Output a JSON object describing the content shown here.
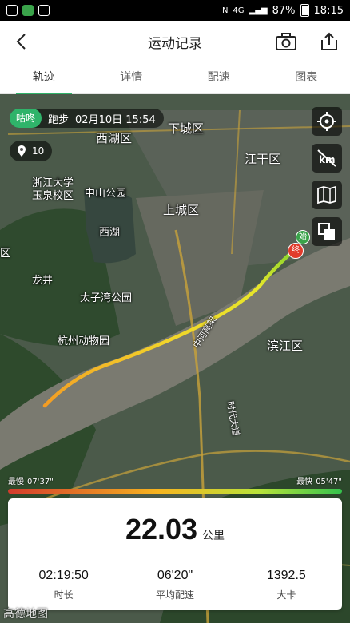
{
  "status_bar": {
    "battery": "87%",
    "time": "18:15",
    "network": "4G"
  },
  "header": {
    "title": "运动记录"
  },
  "tabs": [
    {
      "label": "轨迹",
      "active": true
    },
    {
      "label": "详情",
      "active": false
    },
    {
      "label": "配速",
      "active": false
    },
    {
      "label": "图表",
      "active": false
    }
  ],
  "map": {
    "brand": "咕咚",
    "activity": "跑步",
    "datetime": "02月10日 15:54",
    "marker_count": "10",
    "labels": {
      "xihu_district": "西湖区",
      "xiacheng": "下城区",
      "jianggan": "江干区",
      "zju": "浙江大学",
      "zju_campus": "玉泉校区",
      "zhongshan_park": "中山公园",
      "shangcheng": "上城区",
      "west_lake": "西湖",
      "taiziwan": "太子湾公园",
      "zoo": "杭州动物园",
      "binjiang": "滨江区",
      "start_marker": "始",
      "end_marker": "终",
      "road_label": "中河高架",
      "avenue": "时代大道",
      "longjing": "龙井",
      "left_edge": "区"
    },
    "logo": "高德地图"
  },
  "speed_legend": {
    "slow_label": "最慢",
    "slow_value": "07'37\"",
    "fast_label": "最快",
    "fast_value": "05'47\""
  },
  "summary": {
    "distance": "22.03",
    "distance_unit": "公里",
    "duration": "02:19:50",
    "duration_label": "时长",
    "avg_pace": "06'20\"",
    "avg_pace_label": "平均配速",
    "calories": "1392.5",
    "calories_label": "大卡"
  },
  "colors": {
    "accent": "#2fb36a",
    "route_start": "#f39c24",
    "route_end": "#7bd32d",
    "end_marker": "#e23b2c"
  }
}
